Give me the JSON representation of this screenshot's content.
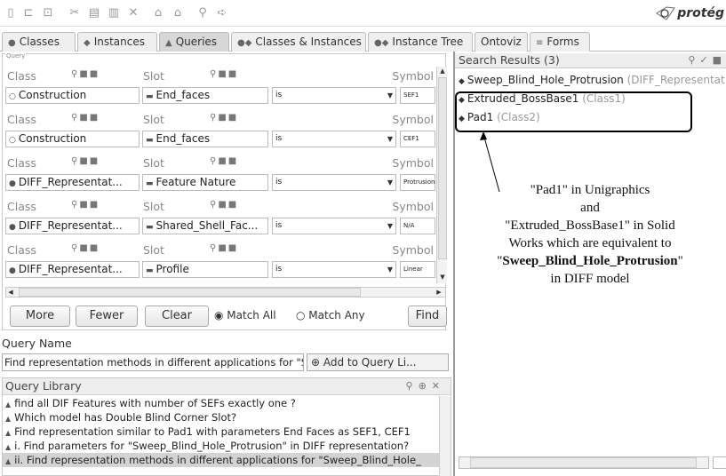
{
  "app": {
    "logo_text": "protég"
  },
  "toolbar": {
    "icons": [
      "new-file-icon",
      "open-folder-icon",
      "save-icon",
      "cut-icon",
      "copy-icon",
      "paste-icon",
      "delete-icon",
      "undo-icon",
      "redo-icon",
      "ref-icon",
      "forward-icon"
    ]
  },
  "tabs": [
    {
      "label": "Classes",
      "icon": "circle-icon",
      "active": false
    },
    {
      "label": "Instances",
      "icon": "diamond-icon",
      "active": false
    },
    {
      "label": "Queries",
      "icon": "triangle-icon",
      "active": true
    },
    {
      "label": "Classes & Instances",
      "icon": "class-instance-icon",
      "active": false
    },
    {
      "label": "Instance Tree",
      "icon": "class-instance-icon",
      "active": false
    },
    {
      "label": "Ontoviz",
      "icon": "",
      "active": false
    },
    {
      "label": "Forms",
      "icon": "forms-icon",
      "active": false
    }
  ],
  "query": {
    "legend": "Query",
    "header": {
      "class": "Class",
      "slot": "Slot",
      "symbol": "Symbol"
    },
    "rows": [
      {
        "class": "Construction",
        "class_bullet": "○",
        "slot": "End_faces",
        "op": "is",
        "symbol": "SEF1"
      },
      {
        "class": "Construction",
        "class_bullet": "○",
        "slot": "End_faces",
        "op": "is",
        "symbol": "CEF1"
      },
      {
        "class": "DIFF_Representat...",
        "class_bullet": "●",
        "slot": "Feature Nature",
        "op": "is",
        "symbol": "Protrusion"
      },
      {
        "class": "DIFF_Representat...",
        "class_bullet": "●",
        "slot": "Shared_Shell_Fac...",
        "op": "is",
        "symbol": "N/A"
      },
      {
        "class": "DIFF_Representat...",
        "class_bullet": "●",
        "slot": "Profile",
        "op": "is",
        "symbol": "Linear"
      }
    ],
    "buttons": {
      "more": "More",
      "fewer": "Fewer",
      "clear": "Clear",
      "find": "Find"
    },
    "match_all": "Match All",
    "match_any": "Match Any"
  },
  "query_name": {
    "label": "Query Name",
    "value": "Find representation methods in different applications for \"Sv",
    "add_button": "Add to Query Li..."
  },
  "library": {
    "title": "Query Library",
    "items": [
      "find all DIF Features with number of SEFs exactly one ?",
      "Which model has Double Blind Corner Slot?",
      "Find representation similar to Pad1 with parameters End Faces as SEF1, CEF1",
      "i. Find parameters for \"Sweep_Blind_Hole_Protrusion\" in DIFF representation?",
      "ii. Find representation methods in different applications for \"Sweep_Blind_Hole_"
    ],
    "selected_index": 4
  },
  "results": {
    "title": "Search Results (3)",
    "items": [
      {
        "name": "Sweep_Blind_Hole_Protrusion",
        "cls": "(DIFF_Representation)"
      },
      {
        "name": "Extruded_BossBase1",
        "cls": "(Class1)"
      },
      {
        "name": "Pad1",
        "cls": "(Class2)"
      }
    ]
  },
  "annotation": {
    "line1": "\"Pad1\" in Unigraphics",
    "line2": "and",
    "line3": "\"Extruded_BossBase1\" in Solid",
    "line4": "Works which are equivalent to",
    "line5_q1": "\"",
    "line5_bold": "Sweep_Blind_Hole_Protrusion",
    "line5_q2": "\"",
    "line6": "in DIFF model"
  }
}
